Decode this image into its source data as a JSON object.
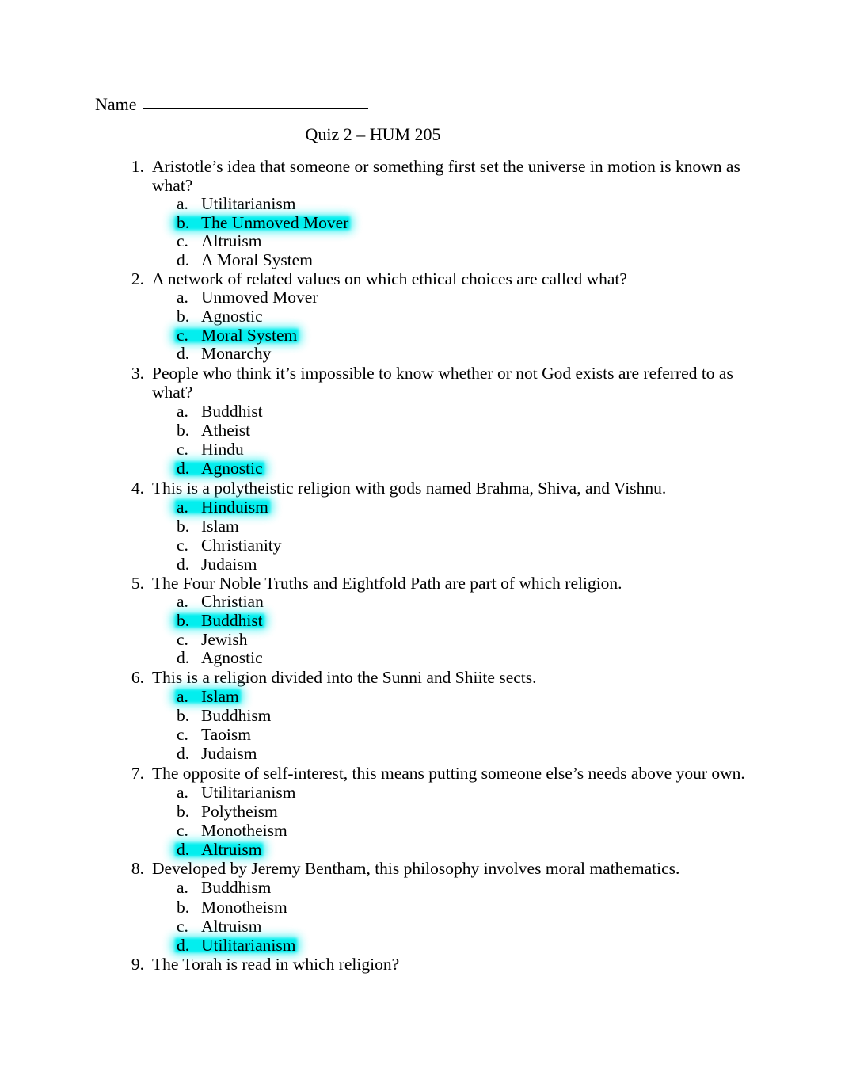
{
  "document": {
    "name_label": "Name",
    "title": "Quiz 2 – HUM 205"
  },
  "questions": [
    {
      "number": "1.",
      "text": "Aristotle’s idea that someone or something first set the universe in motion is known as what?",
      "spacing": "normal",
      "options": [
        {
          "letter": "a.",
          "text": "Utilitarianism",
          "highlighted": false
        },
        {
          "letter": "b.",
          "text": "The Unmoved Mover",
          "highlighted": true
        },
        {
          "letter": "c.",
          "text": "Altruism",
          "highlighted": false
        },
        {
          "letter": "d.",
          "text": "A Moral System",
          "highlighted": false
        }
      ]
    },
    {
      "number": "2.",
      "text": "A network of related values on which ethical choices are called what?",
      "spacing": "normal",
      "options": [
        {
          "letter": "a.",
          "text": "Unmoved Mover",
          "highlighted": false
        },
        {
          "letter": "b.",
          "text": "Agnostic",
          "highlighted": false
        },
        {
          "letter": "c.",
          "text": "Moral System",
          "highlighted": true
        },
        {
          "letter": "d.",
          "text": "Monarchy",
          "highlighted": false
        }
      ]
    },
    {
      "number": "3.",
      "text": "People who think it’s impossible to know whether or not God exists are referred to as what?",
      "spacing": "loose",
      "options": [
        {
          "letter": "a.",
          "text": "Buddhist",
          "highlighted": false
        },
        {
          "letter": "b.",
          "text": "Atheist",
          "highlighted": false
        },
        {
          "letter": "c.",
          "text": "Hindu",
          "highlighted": false
        },
        {
          "letter": "d.",
          "text": "Agnostic",
          "highlighted": true
        }
      ]
    },
    {
      "number": "4.",
      "text": "This is a polytheistic religion with gods named Brahma, Shiva, and Vishnu.",
      "spacing": "loose",
      "options": [
        {
          "letter": "a.",
          "text": "Hinduism",
          "highlighted": true
        },
        {
          "letter": "b.",
          "text": "Islam",
          "highlighted": false
        },
        {
          "letter": "c.",
          "text": "Christianity",
          "highlighted": false
        },
        {
          "letter": "d.",
          "text": "Judaism",
          "highlighted": false
        }
      ]
    },
    {
      "number": "5.",
      "text": "The Four Noble Truths and Eightfold Path are part of which religion.",
      "spacing": "normal",
      "options": [
        {
          "letter": "a.",
          "text": "Christian",
          "highlighted": false
        },
        {
          "letter": "b.",
          "text": "Buddhist",
          "highlighted": true
        },
        {
          "letter": "c.",
          "text": "Jewish",
          "highlighted": false
        },
        {
          "letter": "d.",
          "text": "Agnostic",
          "highlighted": false
        }
      ]
    },
    {
      "number": "6.",
      "text": "This is a religion divided into the Sunni and Shiite sects.",
      "spacing": "loose",
      "options": [
        {
          "letter": "a.",
          "text": "Islam",
          "highlighted": true
        },
        {
          "letter": "b.",
          "text": "Buddhism",
          "highlighted": false
        },
        {
          "letter": "c.",
          "text": "Taoism",
          "highlighted": false
        },
        {
          "letter": "d.",
          "text": "Judaism",
          "highlighted": false
        }
      ]
    },
    {
      "number": "7.",
      "text": "The opposite of self-interest, this means putting someone else’s needs above your own.",
      "spacing": "loose",
      "options": [
        {
          "letter": "a.",
          "text": "Utilitarianism",
          "highlighted": false
        },
        {
          "letter": "b.",
          "text": "Polytheism",
          "highlighted": false
        },
        {
          "letter": "c.",
          "text": "Monotheism",
          "highlighted": false
        },
        {
          "letter": "d.",
          "text": "Altruism",
          "highlighted": true
        }
      ]
    },
    {
      "number": "8.",
      "text": "Developed by Jeremy Bentham, this philosophy involves moral mathematics.",
      "spacing": "loose",
      "options": [
        {
          "letter": "a.",
          "text": "Buddhism",
          "highlighted": false
        },
        {
          "letter": "b.",
          "text": "Monotheism",
          "highlighted": false
        },
        {
          "letter": "c.",
          "text": "Altruism",
          "highlighted": false
        },
        {
          "letter": "d.",
          "text": "Utilitarianism",
          "highlighted": true
        }
      ]
    },
    {
      "number": "9.",
      "text": "The Torah is read in which religion?",
      "spacing": "normal",
      "options": []
    }
  ],
  "colors": {
    "highlight": "#00eeee",
    "text": "#000000",
    "background": "#ffffff"
  }
}
